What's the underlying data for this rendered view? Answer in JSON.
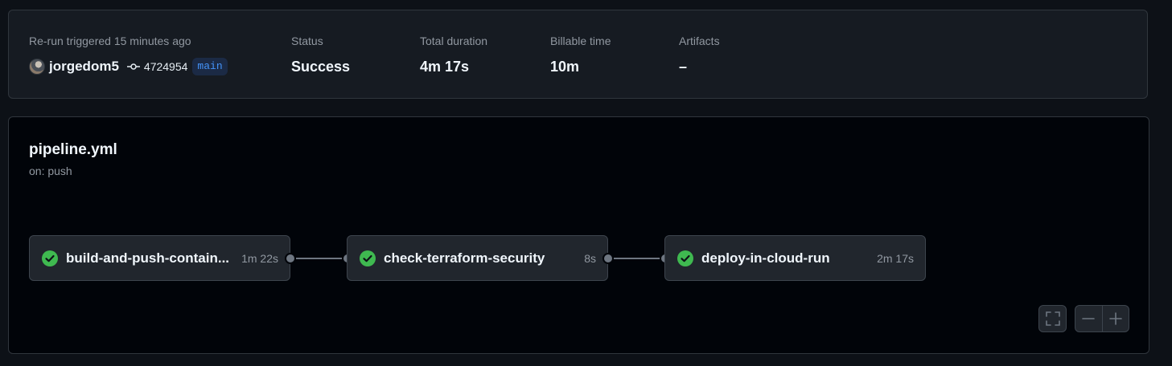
{
  "summary": {
    "trigger_label": "Re-run triggered 15 minutes ago",
    "actor": "jorgedom5",
    "commit": "4724954",
    "branch": "main",
    "status_label": "Status",
    "status_value": "Success",
    "duration_label": "Total duration",
    "duration_value": "4m 17s",
    "billable_label": "Billable time",
    "billable_value": "10m",
    "artifacts_label": "Artifacts",
    "artifacts_value": "–"
  },
  "workflow": {
    "file": "pipeline.yml",
    "trigger": "on: push",
    "jobs": [
      {
        "name": "build-and-push-contain...",
        "duration": "1m 22s",
        "status": "success"
      },
      {
        "name": "check-terraform-security",
        "duration": "8s",
        "status": "success"
      },
      {
        "name": "deploy-in-cloud-run",
        "duration": "2m 17s",
        "status": "success"
      }
    ]
  },
  "controls": {
    "fullscreen_icon": "fullscreen-icon",
    "zoom_out_icon": "zoom-out-icon",
    "zoom_in_icon": "zoom-in-icon"
  },
  "colors": {
    "success": "#3fb950",
    "branch_text": "#4493f8"
  }
}
